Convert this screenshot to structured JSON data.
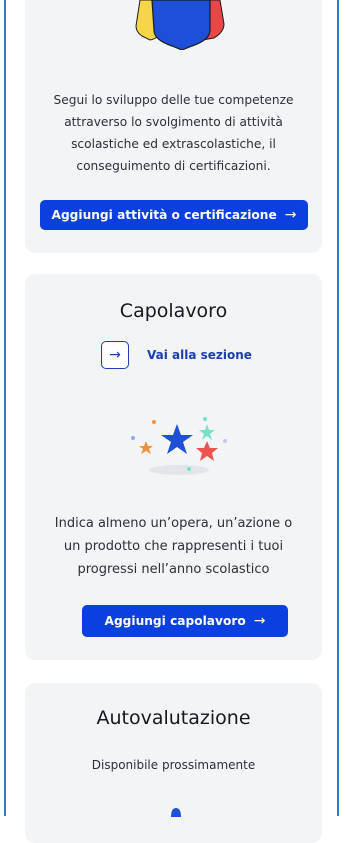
{
  "competenze": {
    "description": "Segui lo sviluppo delle tue competenze\nattraverso lo svolgimento di attività\nscolastiche ed extrascolastiche, il\nconseguimento di certificazioni.",
    "button_label": "Aggiungi attività o certificazione",
    "button_arrow": "→",
    "badge_colors": [
      "#f7d54a",
      "#1e4fd8",
      "#e84747"
    ]
  },
  "capolavoro": {
    "title": "Capolavoro",
    "link_label": "Vai alla sezione",
    "link_icon": "→",
    "description": "Indica almeno un’opera, un’azione o\nun prodotto che rappresenti i tuoi\nprogressi nell’anno scolastico",
    "button_label": "Aggiungi capolavoro",
    "button_arrow": "→",
    "star_colors": [
      "#1e4fd8",
      "#ef5350",
      "#f2913d",
      "#79e0c8"
    ]
  },
  "autovalutazione": {
    "title": "Autovalutazione",
    "status": "Disponibile prossimamente"
  }
}
